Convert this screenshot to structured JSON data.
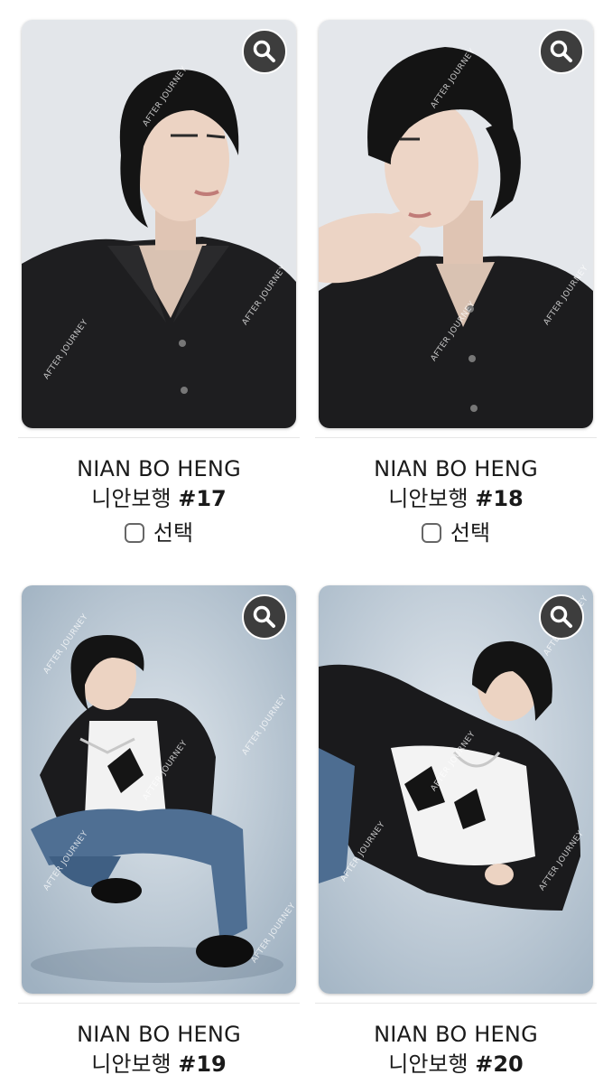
{
  "cards": [
    {
      "name": "NIAN BO HENG",
      "korean_name": "니안보행",
      "number": "#17",
      "select_label": "선택",
      "show_select": true,
      "watermark": "AFTER JOURNEY"
    },
    {
      "name": "NIAN BO HENG",
      "korean_name": "니안보행",
      "number": "#18",
      "select_label": "선택",
      "show_select": true,
      "watermark": "AFTER JOURNEY"
    },
    {
      "name": "NIAN BO HENG",
      "korean_name": "니안보행",
      "number": "#19",
      "select_label": "",
      "show_select": false,
      "watermark": "AFTER JOURNEY"
    },
    {
      "name": "NIAN BO HENG",
      "korean_name": "니안보행",
      "number": "#20",
      "select_label": "",
      "show_select": false,
      "watermark": "AFTER JOURNEY"
    }
  ],
  "icons": {
    "zoom": "magnifier-icon",
    "checkbox": "checkbox-unchecked"
  },
  "colors": {
    "zoom_bg": "#3d3d3d",
    "text": "#1a1a1a",
    "photo_bg_light": "#e3e6ea",
    "photo_bg_blue": "#b8c6d2"
  }
}
